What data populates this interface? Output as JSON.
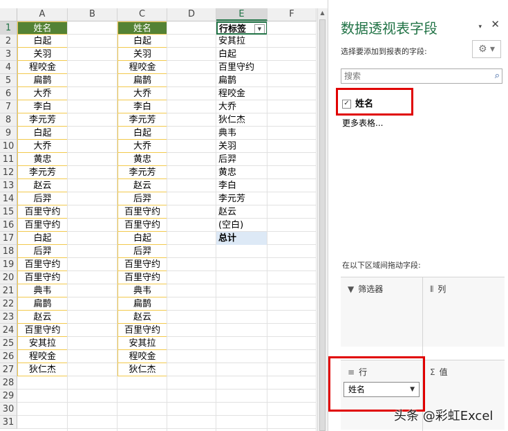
{
  "columns": [
    "A",
    "B",
    "C",
    "D",
    "E",
    "F"
  ],
  "selected_column": "E",
  "row_numbers": [
    "1",
    "2",
    "3",
    "4",
    "5",
    "6",
    "7",
    "8",
    "9",
    "10",
    "11",
    "12",
    "13",
    "14",
    "15",
    "16",
    "17",
    "18",
    "19",
    "20",
    "21",
    "22",
    "23",
    "24",
    "25",
    "26",
    "27",
    "28",
    "29",
    "30",
    "31"
  ],
  "col_a": {
    "header": "姓名",
    "values": [
      "白起",
      "关羽",
      "程咬金",
      "扁鹊",
      "大乔",
      "李白",
      "李元芳",
      "白起",
      "大乔",
      "黄忠",
      "李元芳",
      "赵云",
      "后羿",
      "百里守约",
      "百里守约",
      "白起",
      "后羿",
      "百里守约",
      "百里守约",
      "典韦",
      "扁鹊",
      "赵云",
      "百里守约",
      "安其拉",
      "程咬金",
      "狄仁杰"
    ]
  },
  "col_c": {
    "header": "姓名",
    "values": [
      "白起",
      "关羽",
      "程咬金",
      "扁鹊",
      "大乔",
      "李白",
      "李元芳",
      "白起",
      "大乔",
      "黄忠",
      "李元芳",
      "赵云",
      "后羿",
      "百里守约",
      "百里守约",
      "白起",
      "后羿",
      "百里守约",
      "百里守约",
      "典韦",
      "扁鹊",
      "赵云",
      "百里守约",
      "安其拉",
      "程咬金",
      "狄仁杰"
    ]
  },
  "pivot": {
    "header": "行标签",
    "items": [
      "安其拉",
      "白起",
      "百里守约",
      "扁鹊",
      "程咬金",
      "大乔",
      "狄仁杰",
      "典韦",
      "关羽",
      "后羿",
      "黄忠",
      "李白",
      "李元芳",
      "赵云",
      "(空白)"
    ],
    "total": "总计"
  },
  "pane": {
    "title": "数据透视表字段",
    "close_icon": "✕",
    "dropdown_icon": "▾",
    "subtitle": "选择要添加到报表的字段:",
    "gear_label": "⚙ ▾",
    "search_placeholder": "搜索",
    "field_name": "姓名",
    "field_checked": "✓",
    "more_tables": "更多表格...",
    "drag_hint": "在以下区域间拖动字段:",
    "areas": {
      "filters": "筛选器",
      "columns": "列",
      "rows": "行",
      "values": "值"
    },
    "rows_chip": "姓名"
  },
  "watermark": "头条 @彩虹Excel",
  "colors": {
    "header_green": "#548235",
    "accent_green": "#217346",
    "highlight_red": "#e00000",
    "total_blue": "#dde9f6"
  }
}
